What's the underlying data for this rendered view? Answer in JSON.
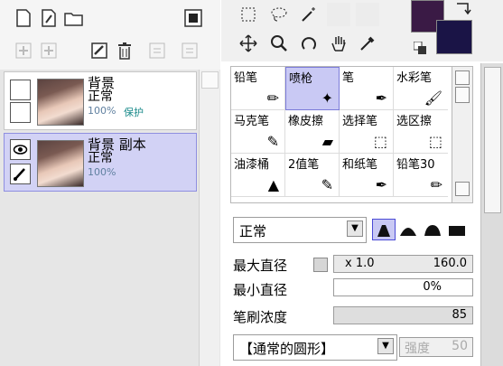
{
  "layer_toolbar": {
    "row1": [
      "new-layer",
      "new-vector-layer",
      "new-folder"
    ],
    "row2": [
      "merge-down",
      "merge-all",
      "clear-layer",
      "delete-layer",
      "transfer-down",
      "transfer-up"
    ]
  },
  "layers": [
    {
      "name": "背景",
      "mode": "正常",
      "opacity": "100%",
      "lock": "保护"
    },
    {
      "name": "背景 副本",
      "mode": "正常",
      "opacity": "100%"
    }
  ],
  "brushes": [
    "铅笔",
    "喷枪",
    "笔",
    "水彩笔",
    "马克笔",
    "橡皮擦",
    "选择笔",
    "选区擦",
    "油漆桶",
    "2值笔",
    "和纸笔",
    "铅笔30"
  ],
  "brush_panel": {
    "blend_mode": "正常",
    "max_size_label": "最大直径",
    "max_size_multiplier": "x 1.0",
    "max_size_value": "160.0",
    "min_size_label": "最小直径",
    "min_size_value": "0%",
    "density_label": "笔刷浓度",
    "density_value": "85",
    "shape": "【通常的圆形】",
    "strength_label": "强度",
    "strength_value": "50"
  },
  "colors": {
    "foreground": "#3a1a45",
    "background": "#1a1446",
    "selection_bg": "#d2d2f5",
    "selection_border": "#8f8fe0"
  }
}
